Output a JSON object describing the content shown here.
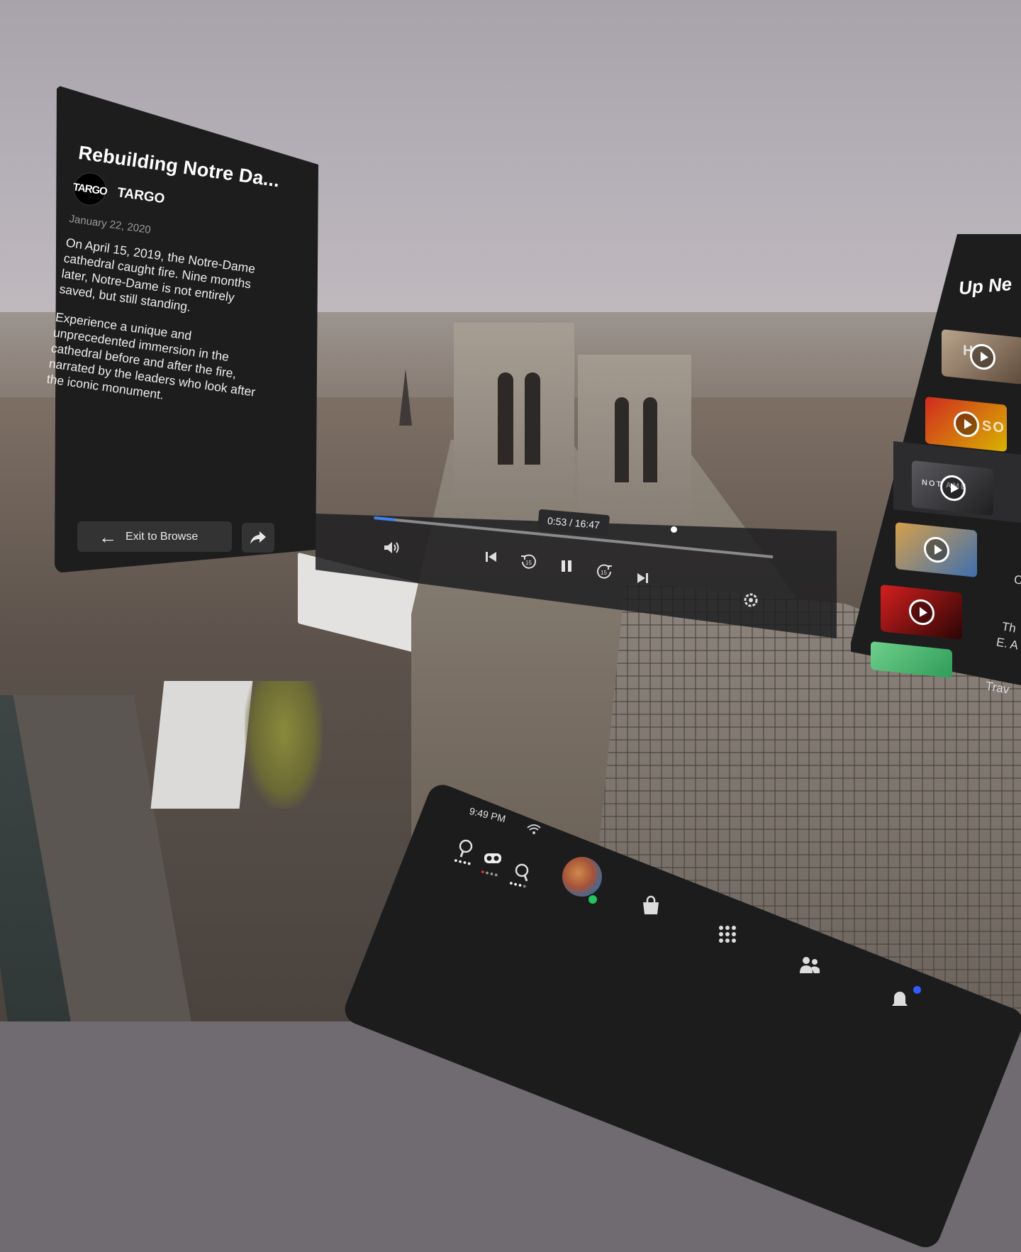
{
  "video": {
    "title": "Rebuilding Notre Da...",
    "channel": {
      "logo_text": "TARGO",
      "name": "TARGO"
    },
    "date": "January 22, 2020",
    "description": [
      "On April 15, 2019, the Notre-Dame cathedral caught fire. Nine months later, Notre-Dame is not entirely saved, but still standing.",
      "Experience a unique and unprecedented immersion in the cathedral before and after the fire, narrated by the leaders who look after the iconic monument."
    ]
  },
  "actions": {
    "exit_label": "Exit to Browse",
    "exit_icon": "arrow-left-icon",
    "share_icon": "share-icon"
  },
  "player": {
    "time_display": "0:53 / 16:47",
    "progress": 0.053,
    "controls": [
      "volume-icon",
      "skip-previous-icon",
      "rewind-15-icon",
      "pause-icon",
      "forward-15-icon",
      "skip-next-icon",
      "settings-icon"
    ],
    "rewind_seconds": "15",
    "forward_seconds": "15",
    "accent_color": "#3b82f6"
  },
  "up_next": {
    "title": "Up Ne",
    "items": [
      {
        "thumb_text": "H",
        "colors": [
          "#b9a58d",
          "#5e4a3a"
        ]
      },
      {
        "thumb_text": "SO",
        "colors": [
          "#d12a1f",
          "#d8b400"
        ]
      },
      {
        "thumb_text": "NOT   AME",
        "colors": [
          "#5a5a5e",
          "#1f1f22"
        ]
      },
      {
        "thumb_text": "",
        "colors": [
          "#d6a04b",
          "#3d6fb0"
        ]
      },
      {
        "thumb_text": "",
        "colors": [
          "#d51f1f",
          "#2a0505"
        ]
      },
      {
        "thumb_text": "",
        "colors": [
          "#6fd08c",
          "#2e9c58"
        ]
      }
    ],
    "side_text": [
      "C",
      "Th",
      "E. A",
      "Trav"
    ]
  },
  "system_bar": {
    "time": "9:49 PM",
    "icons": [
      "wifi-icon",
      "quest-controller-icon",
      "headset-icon",
      "quest-controller-icon",
      "store-icon",
      "apps-grid-icon",
      "people-icon",
      "notifications-icon"
    ],
    "online_color": "#22c55e",
    "notification_color": "#2f5bff"
  }
}
